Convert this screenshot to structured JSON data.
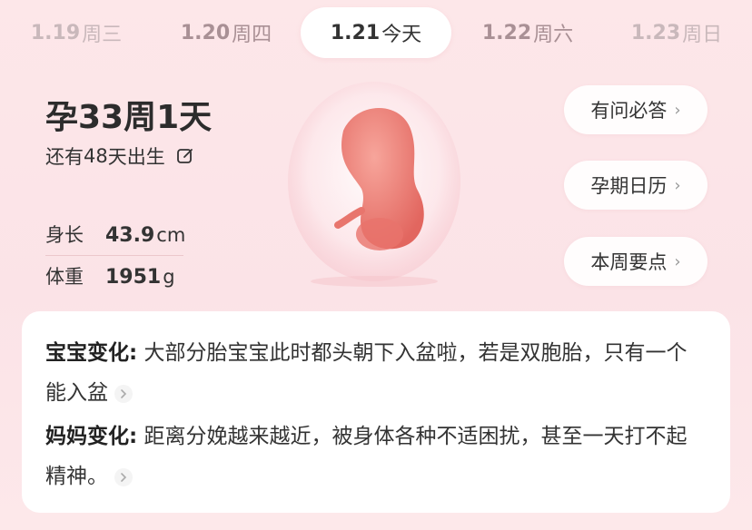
{
  "date_bar": {
    "items": [
      {
        "date": "1.19",
        "weekday": "周三"
      },
      {
        "date": "1.20",
        "weekday": "周四"
      },
      {
        "date": "1.21",
        "weekday": "今天"
      },
      {
        "date": "1.22",
        "weekday": "周六"
      },
      {
        "date": "1.23",
        "weekday": "周日"
      }
    ],
    "selected_index": 2
  },
  "summary": {
    "week_title": "孕33周1天",
    "due_prefix": "还有",
    "due_days": "48",
    "due_suffix": "天出生"
  },
  "stats": {
    "length_label": "身长",
    "length_value": "43.9",
    "length_unit": "cm",
    "weight_label": "体重",
    "weight_value": "1951",
    "weight_unit": "g"
  },
  "side_buttons": {
    "qa_label": "有问必答",
    "calendar_label": "孕期日历",
    "weekly_label": "本周要点"
  },
  "info": {
    "baby_heading": "宝宝变化:",
    "baby_text": " 大部分胎宝宝此时都头朝下入盆啦，若是双胞胎，只有一个能入盆",
    "mom_heading": "妈妈变化:",
    "mom_text": " 距离分娩越来越近，被身体各种不适困扰，甚至一天打不起精神。"
  },
  "icons": {
    "edit": "edit-icon",
    "chevron": "chevron-right-icon",
    "fetus": "fetus-illustration"
  },
  "colors": {
    "background": "#fbe3e7",
    "card": "#ffffff",
    "fetus": "#ee8078"
  }
}
